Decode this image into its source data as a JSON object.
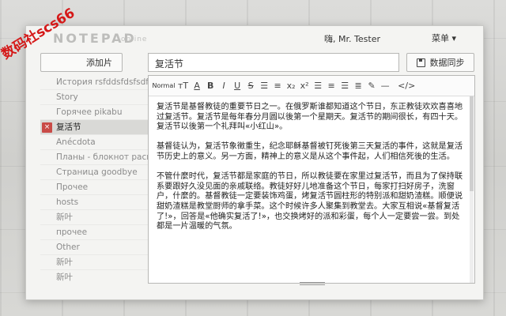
{
  "app": {
    "logo": "NOTEPAD",
    "logo_sub": "online",
    "user_label": "嗨, Mr. Tester",
    "menu_label": "菜单 ▾"
  },
  "watermark": "数码社scs66",
  "toolbar": {
    "add_label": "添加片",
    "title_value": "复活节",
    "sync_label": "数据同步"
  },
  "sidebar": {
    "items": [
      {
        "label": "История rsfddsfdsfsdfsdf",
        "active": false
      },
      {
        "label": "Story",
        "active": false
      },
      {
        "label": "Горячее pikabu",
        "active": false
      },
      {
        "label": "复活节",
        "active": true
      },
      {
        "label": "Anécdota",
        "active": false
      },
      {
        "label": "Планы - блокнот расши",
        "active": false
      },
      {
        "label": "Страница goodbye",
        "active": false
      },
      {
        "label": "Прочее",
        "active": false
      },
      {
        "label": "hosts",
        "active": false
      },
      {
        "label": "新叶",
        "active": false
      },
      {
        "label": "прочее",
        "active": false
      },
      {
        "label": "Other",
        "active": false
      },
      {
        "label": "新叶",
        "active": false
      },
      {
        "label": "新叶",
        "active": false
      }
    ],
    "close_glyph": "×"
  },
  "editor": {
    "format_label": "Normal",
    "paragraphs": [
      "复活节是基督教徒的重要节日之一。在俄罗斯谁都知道这个节日，东正教徒欢欢喜喜地过复活节。复活节是每年春分月圆以後第一个星期天。复活节的期间很长，有四十天。复活节以後第一个礼拜叫«小红山»。",
      "基督徒认为，复活节象徵重生，纪念耶稣基督被钉死後第三天复活的事件，这就是复活节历史上的意义。另一方面，精神上的意义是从这个事件起，人们相信死後的生活。",
      "不管什麼时代，复活节都是家庭的节日，所以教徒要在家里过复活节，而且为了保持联系要跟好久没见面的亲戚联络。教徒好好儿地准备这个节日，每家打扫好房子，洗窗户，什麼的。基督教徒一定要装饰鸡蛋，烤复活节圆柱形的特别派和甜奶渣糕。顺便说甜奶渣糕是教堂厨师的拿手菜。这个时候许多人聚集到教堂去。大家互相说«基督复活了!»，回答是«他确实复活了!»，也交换烤好的派和彩蛋，每个人一定要尝一尝。到处都是一片温暖的气氛。"
    ]
  },
  "colors": {
    "accent_close": "#c94b47",
    "watermark": "#d51818"
  }
}
